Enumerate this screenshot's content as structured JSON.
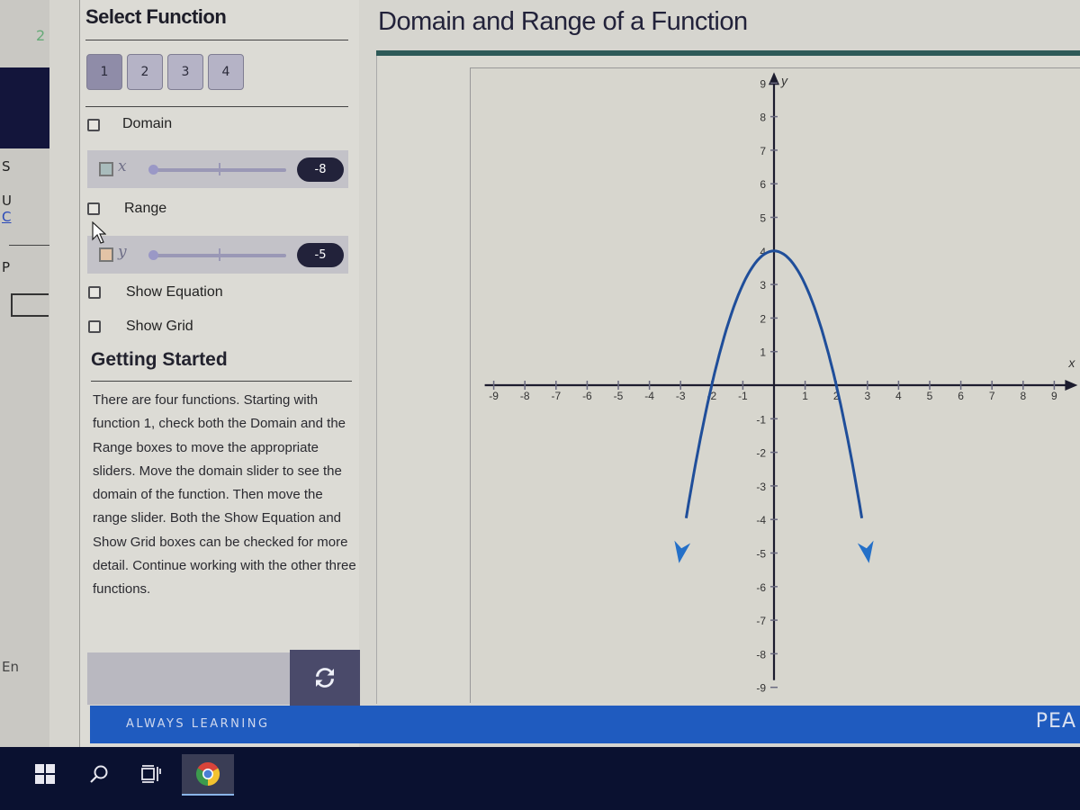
{
  "background_window": {
    "fragments": [
      "2",
      "S",
      "U",
      "C",
      "P",
      "En"
    ]
  },
  "left_panel": {
    "title": "Select Function",
    "function_buttons": [
      {
        "label": "1",
        "selected": true
      },
      {
        "label": "2",
        "selected": false
      },
      {
        "label": "3",
        "selected": false
      },
      {
        "label": "4",
        "selected": false
      }
    ],
    "domain": {
      "label": "Domain",
      "checked": false
    },
    "x_slider": {
      "variable": "x",
      "value": "-8",
      "swatch_color": "#a9bcbc"
    },
    "range": {
      "label": "Range",
      "checked": false
    },
    "y_slider": {
      "variable": "y",
      "value": "-5",
      "swatch_color": "#e3c3a6"
    },
    "show_equation": {
      "label": "Show Equation",
      "checked": false
    },
    "show_grid": {
      "label": "Show Grid",
      "checked": false
    },
    "getting_started": {
      "title": "Getting Started",
      "text": "There are four functions. Starting with function 1, check both the Domain and the Range boxes to move the appropriate sliders. Move the domain slider to see the domain of the function. Then move the range slider. Both the Show Equation and Show Grid boxes can be checked for more detail. Continue working with the other three functions."
    },
    "reset_icon": "refresh-icon"
  },
  "main": {
    "title": "Domain and Range of a Function",
    "accent_color": "#2e5a58"
  },
  "footer": {
    "tagline": "ALWAYS LEARNING",
    "brand": "PEA",
    "color": "#1f5bbf"
  },
  "taskbar": {
    "items": [
      "windows-start-icon",
      "search-icon",
      "task-view-icon",
      "chrome-icon"
    ]
  },
  "chart_data": {
    "type": "line",
    "title": "",
    "xlabel": "x",
    "ylabel": "y",
    "xlim": [
      -9,
      9
    ],
    "ylim": [
      -9,
      9
    ],
    "x_ticks": [
      -9,
      -8,
      -7,
      -6,
      -5,
      -4,
      -3,
      -2,
      -1,
      1,
      2,
      3,
      4,
      5,
      6,
      7,
      8,
      9
    ],
    "y_ticks": [
      9,
      8,
      7,
      6,
      5,
      4,
      3,
      2,
      1,
      -1,
      -2,
      -3,
      -4,
      -5,
      -6,
      -7,
      -8,
      -9
    ],
    "grid": false,
    "series": [
      {
        "name": "function 1",
        "description": "downward parabola y = 4 - x^2 with arrows at both ends",
        "color": "#1f4e9a",
        "vertex": [
          0,
          4
        ],
        "x_intercepts": [
          -2,
          2
        ],
        "x_range": [
          -3.05,
          3.05
        ],
        "points": [
          [
            -3.05,
            -5.3
          ],
          [
            -2.5,
            -2.25
          ],
          [
            -2,
            0
          ],
          [
            -1.5,
            1.75
          ],
          [
            -1,
            3
          ],
          [
            -0.5,
            3.75
          ],
          [
            0,
            4
          ],
          [
            0.5,
            3.75
          ],
          [
            1,
            3
          ],
          [
            1.5,
            1.75
          ],
          [
            2,
            0
          ],
          [
            2.5,
            -2.25
          ],
          [
            3.05,
            -5.3
          ]
        ]
      }
    ]
  }
}
